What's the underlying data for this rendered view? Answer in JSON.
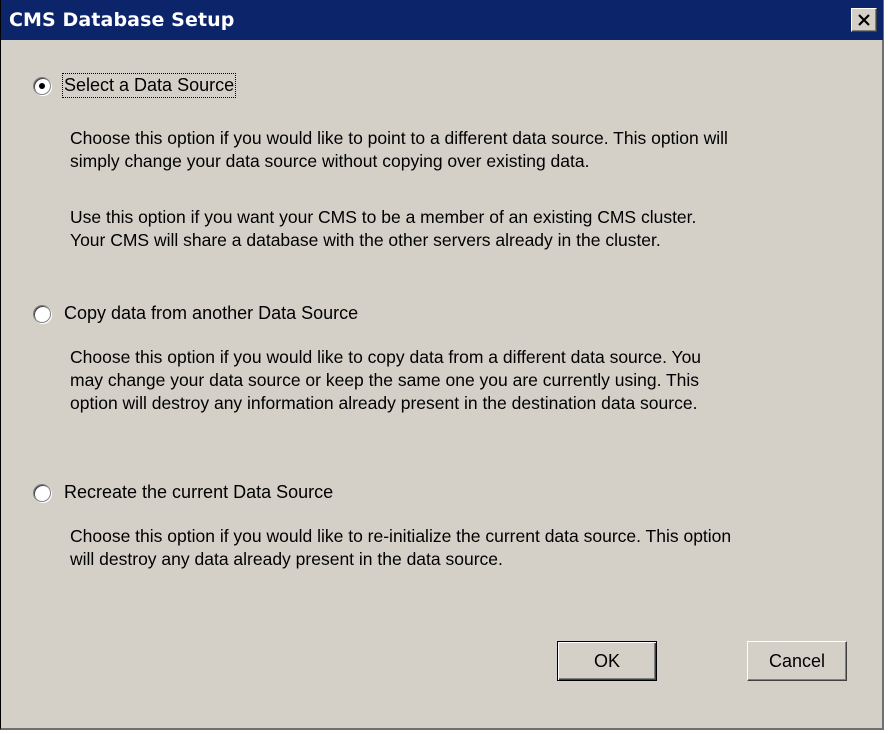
{
  "window": {
    "title": "CMS Database Setup",
    "title_bar_color": "#0b246a",
    "close_icon": "close-icon"
  },
  "options": [
    {
      "label": "Select a Data Source",
      "checked": true,
      "focused": true,
      "description": [
        "Choose this option if you would like to point to a different data source. This option will",
        "simply change your data source without copying over existing data.",
        "",
        "Use this option if you want your CMS to be a member of an existing CMS cluster.",
        "Your CMS will share a database with the other servers already in the cluster."
      ]
    },
    {
      "label": "Copy data from another Data Source",
      "checked": false,
      "focused": false,
      "description": [
        "Choose this option if you would like to copy data from a different data source. You",
        "may change your data source or keep the same one you are currently using. This",
        "option will destroy any information already present in the destination data source."
      ]
    },
    {
      "label": "Recreate the current Data Source",
      "checked": false,
      "focused": false,
      "description": [
        "Choose this option if you would like to re-initialize the current data source. This option",
        "will destroy any data already present in the data source."
      ]
    }
  ],
  "buttons": {
    "ok_label": "OK",
    "cancel_label": "Cancel"
  }
}
